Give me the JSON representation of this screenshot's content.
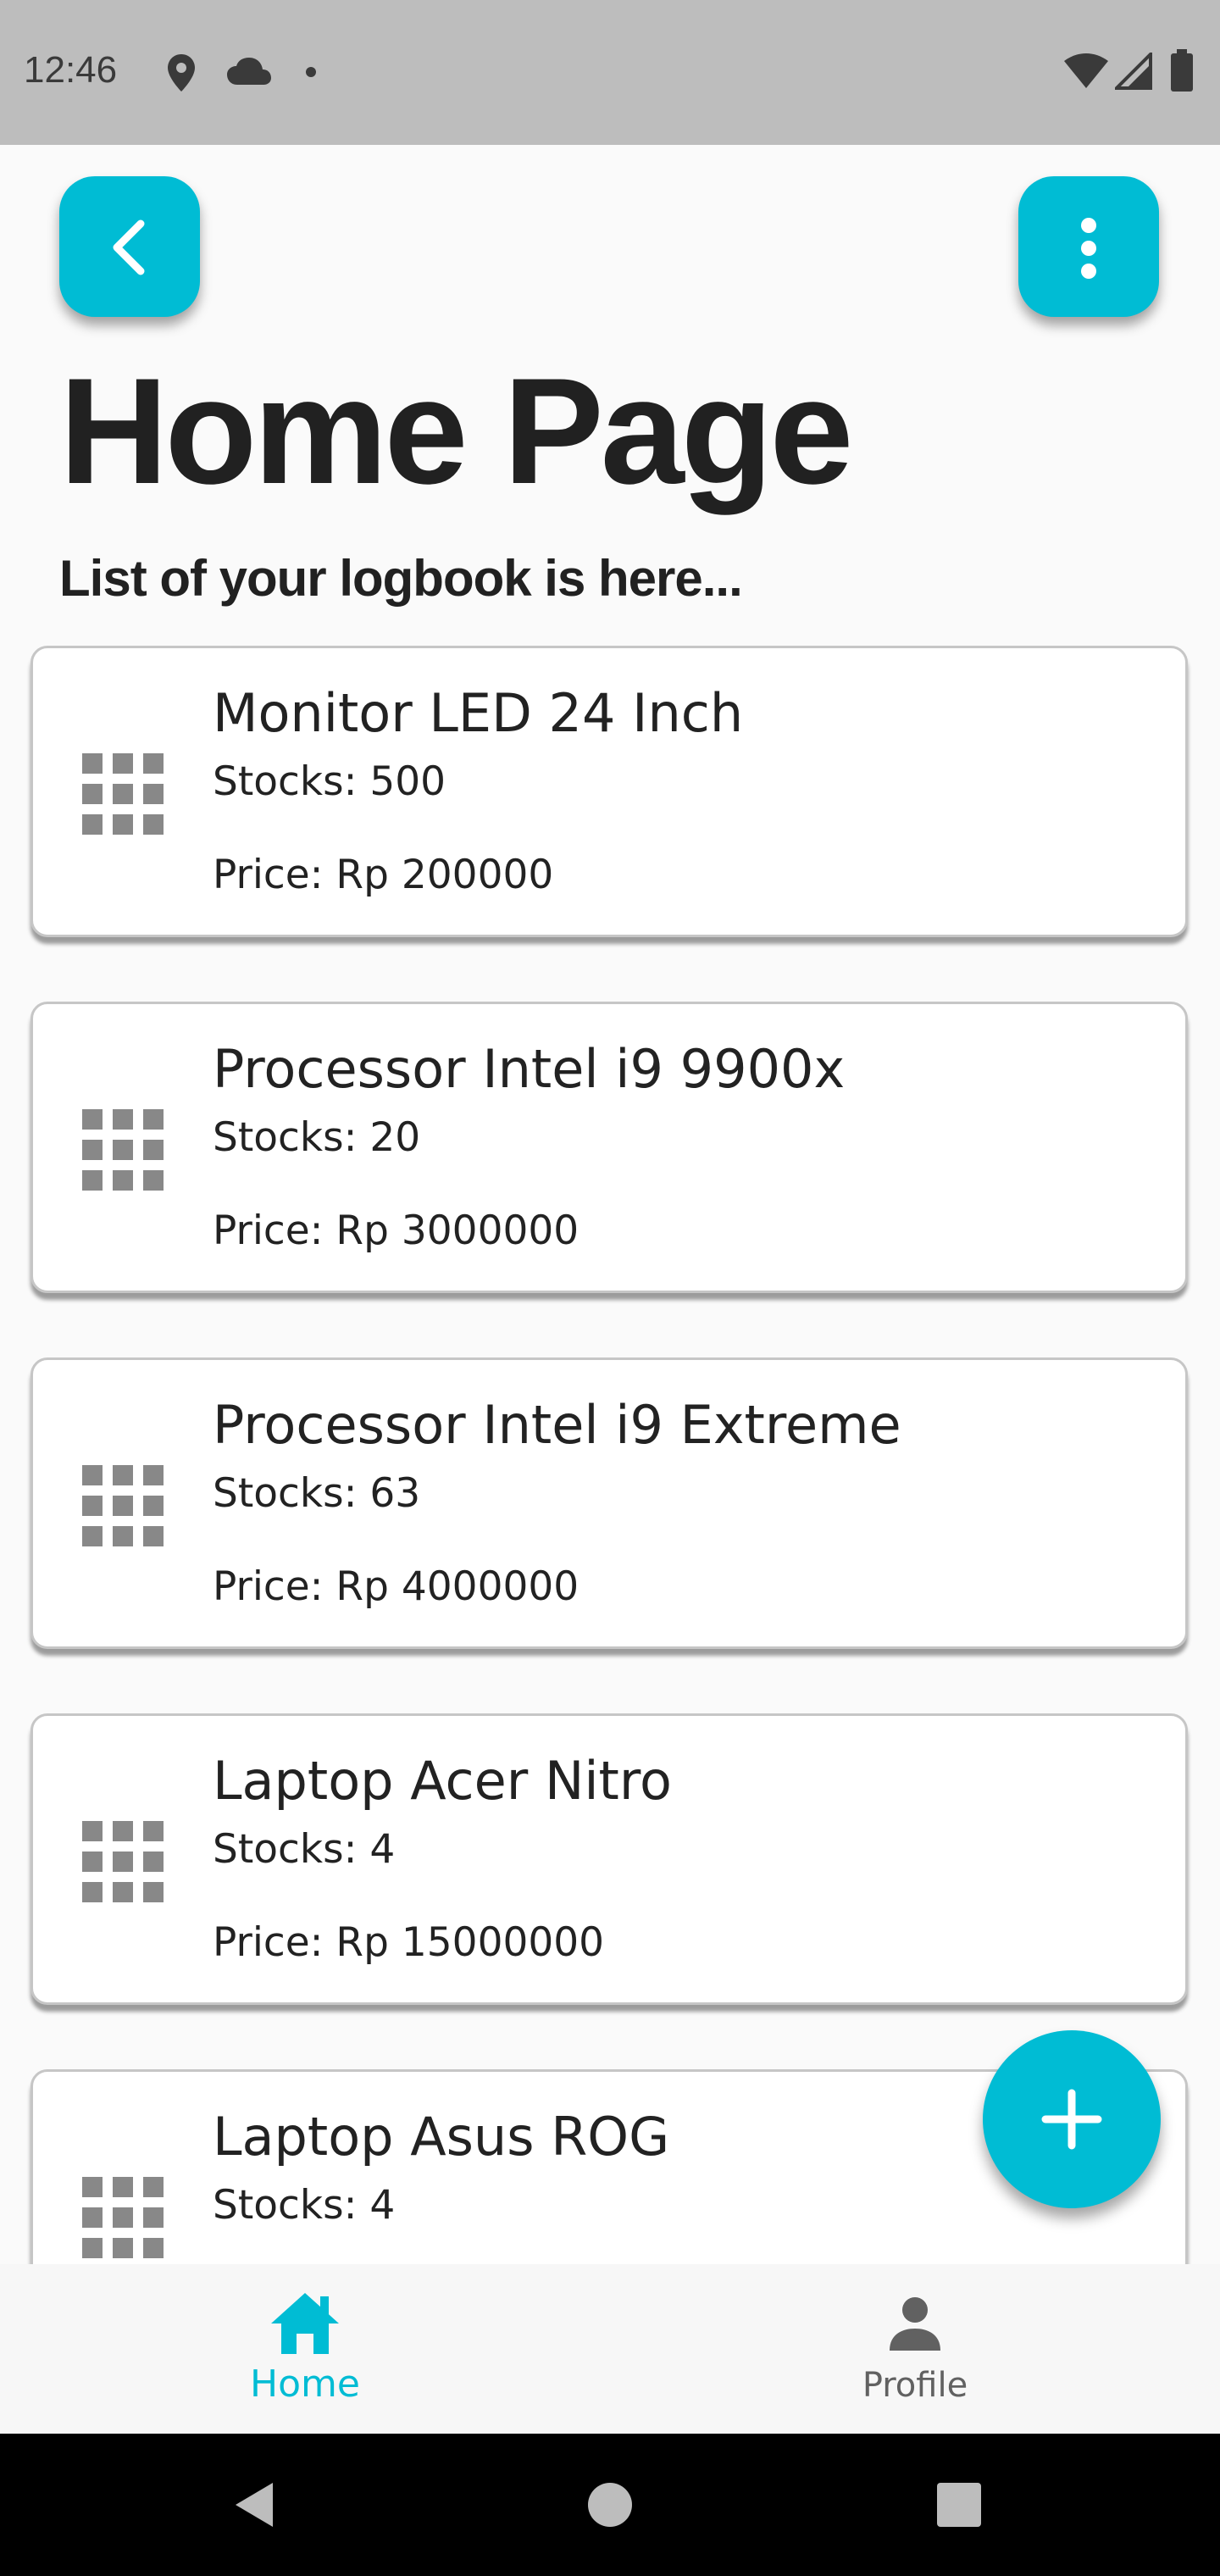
{
  "status_bar": {
    "time": "12:46",
    "left_icons": [
      "location-icon",
      "cloud-icon",
      "dot-icon"
    ],
    "right_icons": [
      "wifi-icon",
      "signal-icon",
      "battery-icon"
    ]
  },
  "header": {
    "back_icon": "chevron-left-icon",
    "menu_icon": "more-vertical-icon",
    "title": "Home Page",
    "subtitle": "List of your logbook is here..."
  },
  "items": [
    {
      "name": "Monitor LED 24 Inch",
      "stock": "Stocks: 500",
      "price": "Price: Rp 200000"
    },
    {
      "name": "Processor Intel i9 9900x",
      "stock": "Stocks: 20",
      "price": "Price: Rp 3000000"
    },
    {
      "name": "Processor Intel i9 Extreme",
      "stock": "Stocks: 63",
      "price": "Price: Rp 4000000"
    },
    {
      "name": "Laptop Acer Nitro",
      "stock": "Stocks: 4",
      "price": "Price: Rp 15000000"
    },
    {
      "name": "Laptop Asus ROG",
      "stock": "Stocks: 4",
      "price": ""
    }
  ],
  "item_icon": "grid-icon",
  "fab_icon": "plus-icon",
  "bottom_nav": {
    "home_label": "Home",
    "profile_label": "Profile",
    "active": "Home"
  },
  "colors": {
    "accent": "#00bcd4",
    "status_bar": "#bdbdbd",
    "inactive_nav": "#616161"
  }
}
